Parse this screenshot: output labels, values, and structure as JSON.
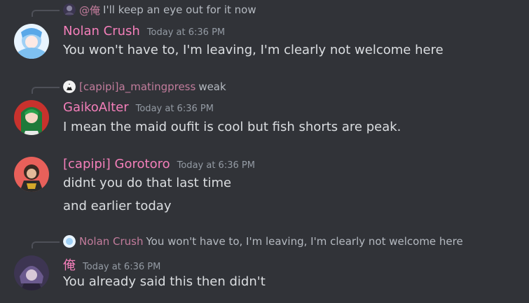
{
  "messages": [
    {
      "reply": {
        "name": "@俺",
        "text": "I'll keep an eye out for it now"
      },
      "username": "Nolan Crush",
      "timestamp": "Today at 6:36 PM",
      "lines": [
        "You won't have to, I'm leaving, I'm clearly not welcome here"
      ]
    },
    {
      "reply": {
        "name": "[capipi]a_matingpress",
        "text": "weak"
      },
      "username": "GaikoAlter",
      "timestamp": "Today at 6:36 PM",
      "lines": [
        "I mean the maid oufit is cool but fish shorts are peak."
      ]
    },
    {
      "username": "[capipi] Gorotoro",
      "timestamp": "Today at 6:36 PM",
      "lines": [
        "didnt you do that last time",
        "and earlier today"
      ]
    },
    {
      "reply": {
        "name": "Nolan Crush",
        "text": "You won't have to, I'm leaving, I'm clearly not welcome here"
      },
      "username": "俺",
      "timestamp": "Today at 6:36 PM",
      "lines": [
        "You already said this then didn't"
      ]
    }
  ],
  "colors": {
    "background": "#313338",
    "username": "#f47fba",
    "reply_name": "#c27c9c",
    "text": "#dbdee1",
    "timestamp": "#949ba4"
  }
}
